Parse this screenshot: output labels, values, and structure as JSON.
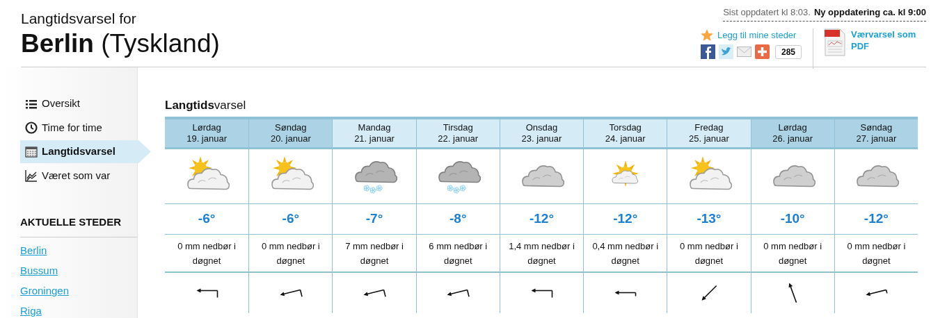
{
  "header": {
    "subtitle": "Langtidsvarsel for",
    "title": "**Berlin** (Tyskland)",
    "updated": "Sist oppdatert kl 8:03.",
    "next_update": "Ny oppdatering ca. kl 9:00",
    "favorite_link": "Legg til mine steder",
    "share_count": "285",
    "pdf_link": "Værvarsel som PDF"
  },
  "sidebar": {
    "items": [
      {
        "label": "Oversikt",
        "selected": false
      },
      {
        "label": "Time for time",
        "selected": false
      },
      {
        "label": "Langtidsvarsel",
        "selected": true
      },
      {
        "label": "Været som var",
        "selected": false
      }
    ],
    "places_heading": "AKTUELLE STEDER",
    "places": [
      "Berlin",
      "Bussum",
      "Groningen",
      "Riga"
    ]
  },
  "forecast": {
    "title": "**Langtids**varsel",
    "days": [
      {
        "day": "Lørdag",
        "date": "19. januar",
        "kind": "weekend",
        "temperature": "-6°",
        "precipitation": "0 mm nedbør i døgnet"
      },
      {
        "day": "Søndag",
        "date": "20. januar",
        "kind": "weekend",
        "temperature": "-6°",
        "precipitation": "0 mm nedbør i døgnet"
      },
      {
        "day": "Mandag",
        "date": "21. januar",
        "kind": "weekday",
        "temperature": "-7°",
        "precipitation": "7 mm nedbør i døgnet"
      },
      {
        "day": "Tirsdag",
        "date": "22. januar",
        "kind": "weekday",
        "temperature": "-8°",
        "precipitation": "6 mm nedbør i døgnet"
      },
      {
        "day": "Onsdag",
        "date": "23. januar",
        "kind": "weekday",
        "temperature": "-12°",
        "precipitation": "1,4 mm nedbør i døgnet"
      },
      {
        "day": "Torsdag",
        "date": "24. januar",
        "kind": "weekday",
        "temperature": "-12°",
        "precipitation": "0,4 mm nedbør i døgnet"
      },
      {
        "day": "Fredag",
        "date": "25. januar",
        "kind": "weekday",
        "temperature": "-13°",
        "precipitation": "0 mm nedbør i døgnet"
      },
      {
        "day": "Lørdag",
        "date": "26. januar",
        "kind": "weekend",
        "temperature": "-10°",
        "precipitation": "0 mm nedbør i døgnet"
      },
      {
        "day": "Søndag",
        "date": "27. januar",
        "kind": "weekend",
        "temperature": "-12°",
        "precipitation": "0 mm nedbør i døgnet"
      }
    ]
  }
}
